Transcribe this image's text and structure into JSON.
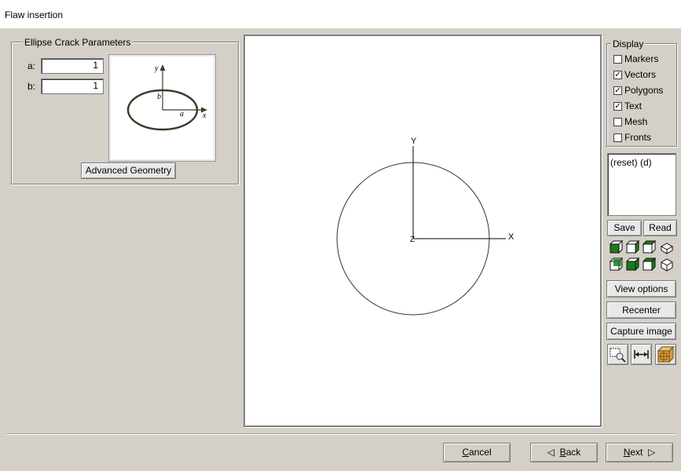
{
  "window": {
    "title": "Flaw insertion"
  },
  "ellipse": {
    "group_title": "Ellipse Crack Parameters",
    "a_label": "a:",
    "a_value": "1",
    "b_label": "b:",
    "b_value": "1",
    "advanced_button": "Advanced Geometry",
    "diagram": {
      "x_label": "x",
      "y_label": "y",
      "a_label": "a",
      "b_label": "b"
    }
  },
  "viewport": {
    "axis_y": "Y",
    "axis_x": "X",
    "axis_z": "Z"
  },
  "display": {
    "group_title": "Display",
    "options": [
      {
        "label": "Markers",
        "checked": false
      },
      {
        "label": "Vectors",
        "checked": true
      },
      {
        "label": "Polygons",
        "checked": true
      },
      {
        "label": "Text",
        "checked": true
      },
      {
        "label": "Mesh",
        "checked": false
      },
      {
        "label": "Fronts",
        "checked": false
      }
    ],
    "log_text": "(reset) (d)",
    "save_button": "Save",
    "read_button": "Read",
    "view_options_button": "View options",
    "recenter_button": "Recenter",
    "capture_button": "Capture image"
  },
  "nav": {
    "cancel_rest": "ancel",
    "cancel_key": "C",
    "back_rest": "ack",
    "back_key": "B",
    "back_arrow": "◁",
    "next_rest": "ext",
    "next_key": "N",
    "next_arrow": "▷"
  },
  "colors": {
    "cube_green": "#1d7a1d",
    "highlight": "#e8a33c"
  }
}
